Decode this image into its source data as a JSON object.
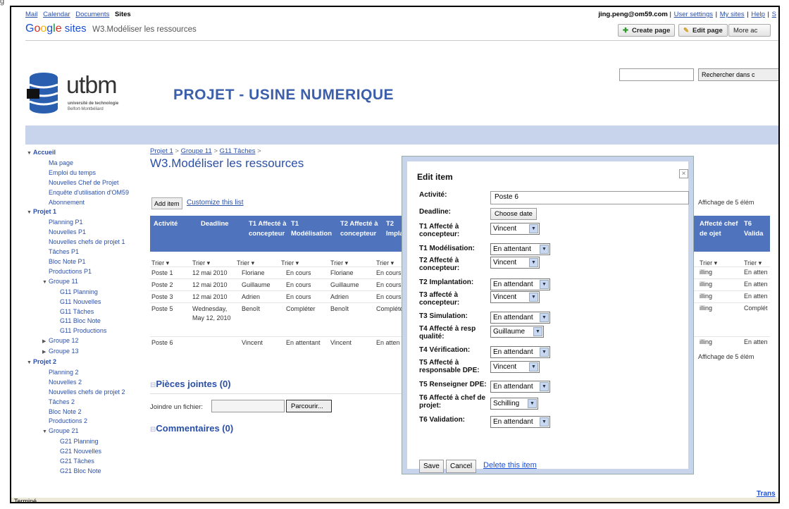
{
  "topnav": {
    "mail": "Mail",
    "calendar": "Calendar",
    "documents": "Documents",
    "sites": "Sites"
  },
  "userbar": {
    "email": "jing.peng@om59.com",
    "sep": "|",
    "settings": "User settings",
    "mysites": "My sites",
    "help": "Help",
    "more": "S"
  },
  "header": {
    "brand": "Google sites",
    "page_title": "W3.Modéliser les ressources",
    "create_page": "Create page",
    "edit_page": "Edit page",
    "more_actions": "More ac",
    "search_button": "Rechercher dans c",
    "site_title": "PROJET - USINE NUMERIQUE",
    "logo_text": "utbm",
    "logo_sub1": "université de technologie",
    "logo_sub2": "Belfort-Montbéliard"
  },
  "sidebar": {
    "items": [
      {
        "label": "Accueil",
        "level": "sec"
      },
      {
        "label": "Ma page",
        "level": "l1"
      },
      {
        "label": "Emploi du temps",
        "level": "l1"
      },
      {
        "label": "Nouvelles Chef de Projet",
        "level": "l1"
      },
      {
        "label": "Enquête d'utilisation d'OM59",
        "level": "l1"
      },
      {
        "label": "Abonnement",
        "level": "l1"
      },
      {
        "label": "Projet 1",
        "level": "sec"
      },
      {
        "label": "Planning P1",
        "level": "l1"
      },
      {
        "label": "Nouvelles P1",
        "level": "l1"
      },
      {
        "label": "Nouvelles chefs de projet 1",
        "level": "l1"
      },
      {
        "label": "Tâches P1",
        "level": "l1"
      },
      {
        "label": "Bloc Note P1",
        "level": "l1"
      },
      {
        "label": "Productions P1",
        "level": "l1"
      },
      {
        "label": "Groupe 11",
        "level": "l2o"
      },
      {
        "label": "G11 Planning",
        "level": "l3"
      },
      {
        "label": "G11 Nouvelles",
        "level": "l3"
      },
      {
        "label": "G11 Tâches",
        "level": "l3"
      },
      {
        "label": "G11 Bloc Note",
        "level": "l3"
      },
      {
        "label": "G11 Productions",
        "level": "l3"
      },
      {
        "label": "Groupe 12",
        "level": "l2c"
      },
      {
        "label": "Groupe 13",
        "level": "l2c"
      },
      {
        "label": "Projet 2",
        "level": "sec"
      },
      {
        "label": "Planning 2",
        "level": "l1"
      },
      {
        "label": "Nouvelles 2",
        "level": "l1"
      },
      {
        "label": "Nouvelles chefs de projet 2",
        "level": "l1"
      },
      {
        "label": "Tâches 2",
        "level": "l1"
      },
      {
        "label": "Bloc Note 2",
        "level": "l1"
      },
      {
        "label": "Productions 2",
        "level": "l1"
      },
      {
        "label": "Groupe 21",
        "level": "l2o"
      },
      {
        "label": "G21 Planning",
        "level": "l3"
      },
      {
        "label": "G21 Nouvelles",
        "level": "l3"
      },
      {
        "label": "G21 Tâches",
        "level": "l3"
      },
      {
        "label": "G21 Bloc Note",
        "level": "l3"
      }
    ]
  },
  "main": {
    "breadcrumb": [
      "Projet 1",
      "Groupe 11",
      "G11 Tâches"
    ],
    "crumb_sep": ">",
    "title": "W3.Modéliser les ressources",
    "add_item": "Add item",
    "customize": "Customize this list",
    "affichage": "Affichage de 5 élém",
    "affichage2": "Affichage de 5 élém",
    "columns": [
      "Activité",
      "Deadline",
      "T1 Affecté à concepteur",
      "T1 Modélisation",
      "T2 Affecté à concepteur",
      "T2 Implant"
    ],
    "columns_right": [
      "Affecté chef de ojet",
      "T6 Valida"
    ],
    "trier": "Trier",
    "rows": [
      {
        "cells": [
          "Poste 1",
          "12 mai 2010",
          "Floriane",
          "En cours",
          "Floriane",
          "En cours"
        ],
        "right": [
          "illing",
          "En atten"
        ]
      },
      {
        "cells": [
          "Poste 2",
          "12 mai 2010",
          "Guillaume",
          "En cours",
          "Guillaume",
          "En cours"
        ],
        "right": [
          "illing",
          "En atten"
        ]
      },
      {
        "cells": [
          "Poste 3",
          "12 mai 2010",
          "Adrien",
          "En cours",
          "Adrien",
          "En cours"
        ],
        "right": [
          "illing",
          "En atten"
        ]
      },
      {
        "cells": [
          "Poste 5",
          "Wednesday, May 12, 2010",
          "Benoît",
          "Compléter",
          "Benoît",
          "Complété"
        ],
        "right": [
          "illing",
          "Complét"
        ]
      },
      {
        "cells": [
          "Poste 6",
          "",
          "Vincent",
          "En attentant",
          "Vincent",
          "En atten"
        ],
        "right": [
          "illing",
          "En atten"
        ]
      }
    ],
    "attachments": "Pièces jointes (0)",
    "joindre": "Joindre un fichier:",
    "parcourir": "Parcourir...",
    "comments": "Commentaires (0)",
    "trans": "Trans"
  },
  "dialog": {
    "title": "Edit item",
    "close": "×",
    "fields": [
      {
        "label": "Activité:",
        "kind": "input",
        "value": "Poste 6"
      },
      {
        "label": "Deadline:",
        "kind": "date",
        "value": "Choose date"
      },
      {
        "label": "T1 Affecté à concepteur:",
        "kind": "select",
        "value": "Vincent"
      },
      {
        "label": "T1 Modélisation:",
        "kind": "select",
        "value": "En attentant"
      },
      {
        "label": "T2 Affecté à concepteur:",
        "kind": "select",
        "value": "Vincent"
      },
      {
        "label": "T2 Implantation:",
        "kind": "select",
        "value": "En attendant"
      },
      {
        "label": "T3 affecté à concepteur:",
        "kind": "select",
        "value": "Vincent"
      },
      {
        "label": "T3 Simulation:",
        "kind": "select",
        "value": "En attendant"
      },
      {
        "label": "T4 Affecté à resp qualité:",
        "kind": "select",
        "value": "Guillaume"
      },
      {
        "label": "T4 Vérification:",
        "kind": "select",
        "value": "En attendant"
      },
      {
        "label": "T5 Affecté à responsable DPE:",
        "kind": "select",
        "value": "Vincent"
      },
      {
        "label": "T5 Renseigner DPE:",
        "kind": "select",
        "value": "En attendant"
      },
      {
        "label": "T6 Affecté à chef de projet:",
        "kind": "select",
        "value": "Schilling"
      },
      {
        "label": "T6 Validation:",
        "kind": "select",
        "value": "En attendant"
      }
    ],
    "save": "Save",
    "cancel": "Cancel",
    "delete": "Delete this item"
  },
  "status": {
    "text": "Terminé"
  },
  "colors": {
    "accent": "#4f73bd",
    "bar": "#c8d3ec",
    "link": "#2a4fa8"
  }
}
